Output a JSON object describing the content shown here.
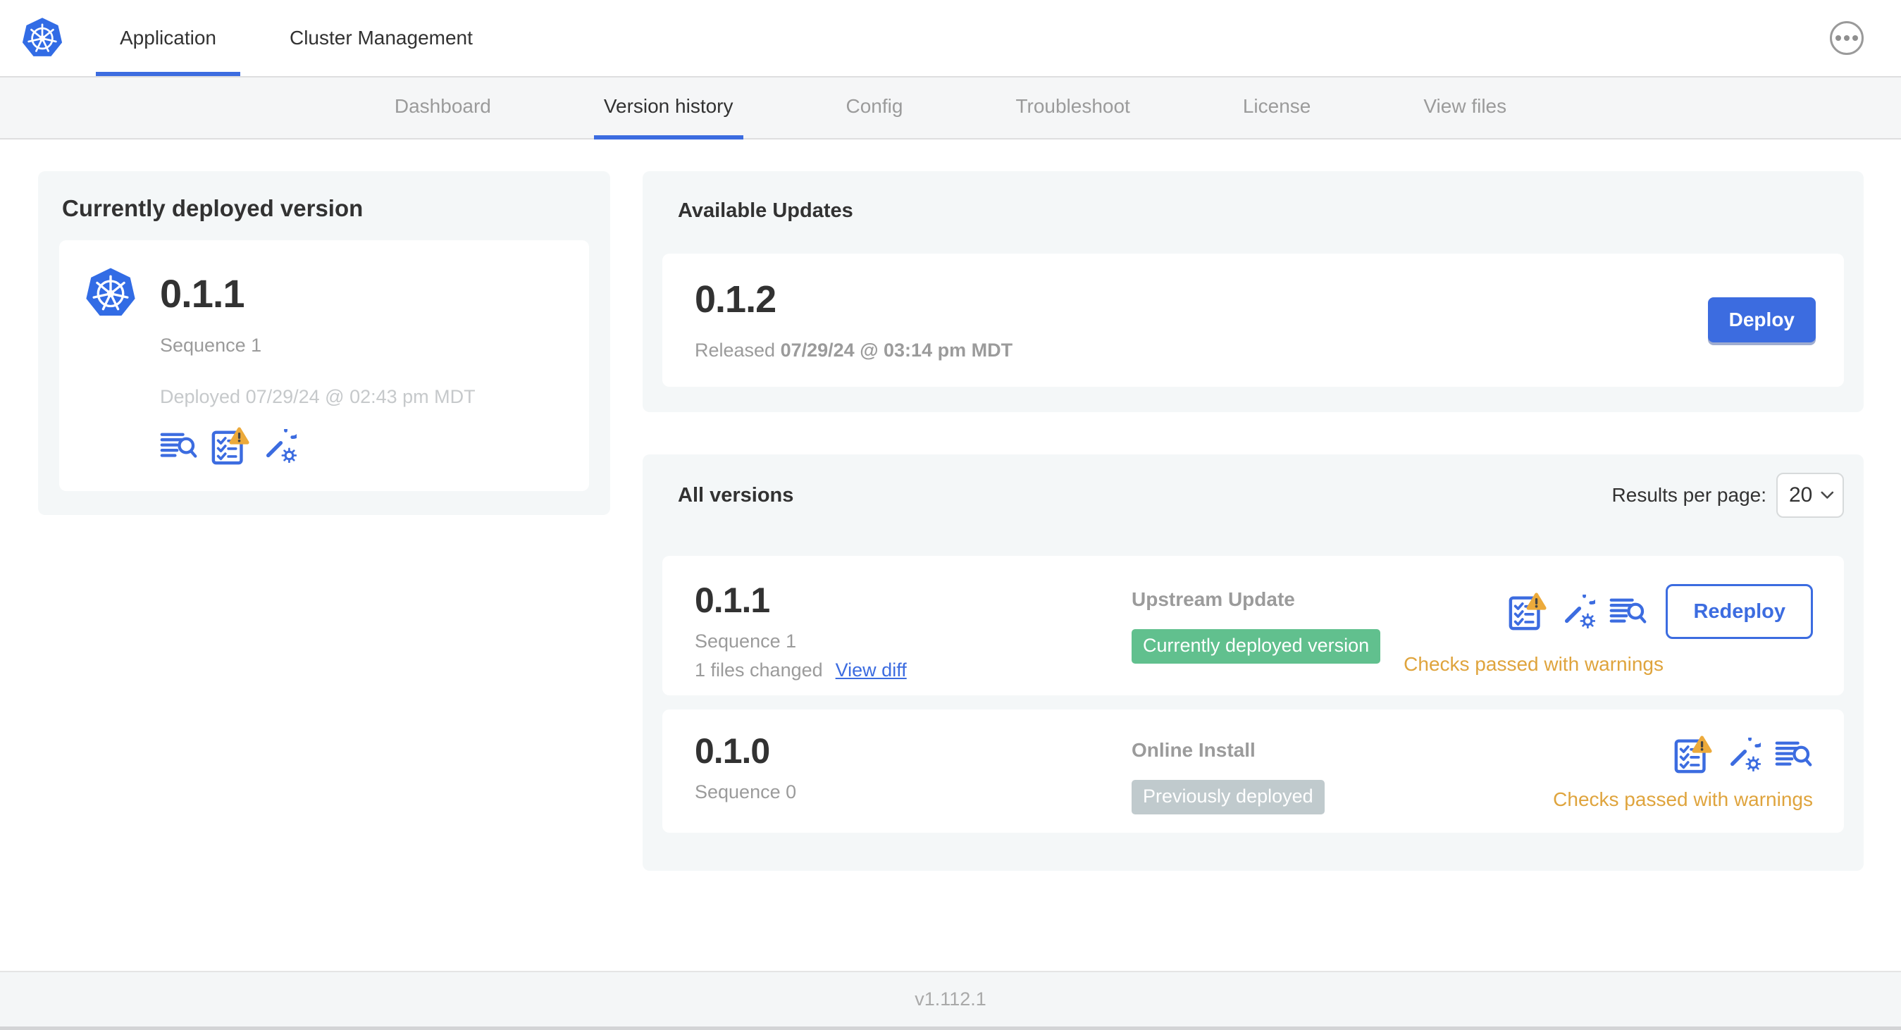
{
  "header": {
    "logo_icon": "kubernetes-logo",
    "tabs": [
      {
        "label": "Application",
        "active": true
      },
      {
        "label": "Cluster Management",
        "active": false
      }
    ],
    "menu_icon": "ellipsis-icon"
  },
  "subnav": {
    "items": [
      {
        "label": "Dashboard",
        "active": false
      },
      {
        "label": "Version history",
        "active": true
      },
      {
        "label": "Config",
        "active": false
      },
      {
        "label": "Troubleshoot",
        "active": false
      },
      {
        "label": "License",
        "active": false
      },
      {
        "label": "View files",
        "active": false
      }
    ]
  },
  "current_version_card": {
    "title": "Currently deployed version",
    "app_icon": "kubernetes-logo",
    "version": "0.1.1",
    "sequence": "Sequence 1",
    "deployed": "Deployed 07/29/24 @ 02:43 pm MDT",
    "icons": [
      "diff-logs-icon",
      "preflight-checks-warning-icon",
      "config-wrench-icon"
    ]
  },
  "available_updates": {
    "title": "Available Updates",
    "version": "0.1.2",
    "released_prefix": "Released ",
    "released_date": "07/29/24 @ 03:14 pm MDT",
    "deploy_label": "Deploy"
  },
  "all_versions": {
    "title": "All versions",
    "results_per_page_label": "Results per page:",
    "results_per_page_value": "20",
    "rows": [
      {
        "version": "0.1.1",
        "sequence": "Sequence 1",
        "files_changed": "1 files changed",
        "view_diff_label": "View diff",
        "source": "Upstream Update",
        "badge_label": "Currently deployed version",
        "badge_type": "success",
        "icons": [
          "preflight-checks-warning-icon",
          "config-wrench-icon",
          "diff-logs-icon"
        ],
        "action_label": "Redeploy",
        "checks_text": "Checks passed with warnings"
      },
      {
        "version": "0.1.0",
        "sequence": "Sequence 0",
        "source": "Online Install",
        "badge_label": "Previously deployed",
        "badge_type": "muted",
        "icons": [
          "preflight-checks-warning-icon",
          "config-wrench-icon",
          "diff-logs-icon"
        ],
        "checks_text": "Checks passed with warnings"
      }
    ]
  },
  "footer": {
    "version": "v1.112.1"
  },
  "colors": {
    "accent_blue": "#3c6ce0",
    "k8s_logo_blue": "#326ce5",
    "success_green": "#61c08e",
    "muted_badge_gray": "#c0cacd",
    "warning_orange": "#dfa43d",
    "text_dark": "#323232",
    "text_gray": "#9b9b9b",
    "panel_gray": "#f4f7f8"
  }
}
